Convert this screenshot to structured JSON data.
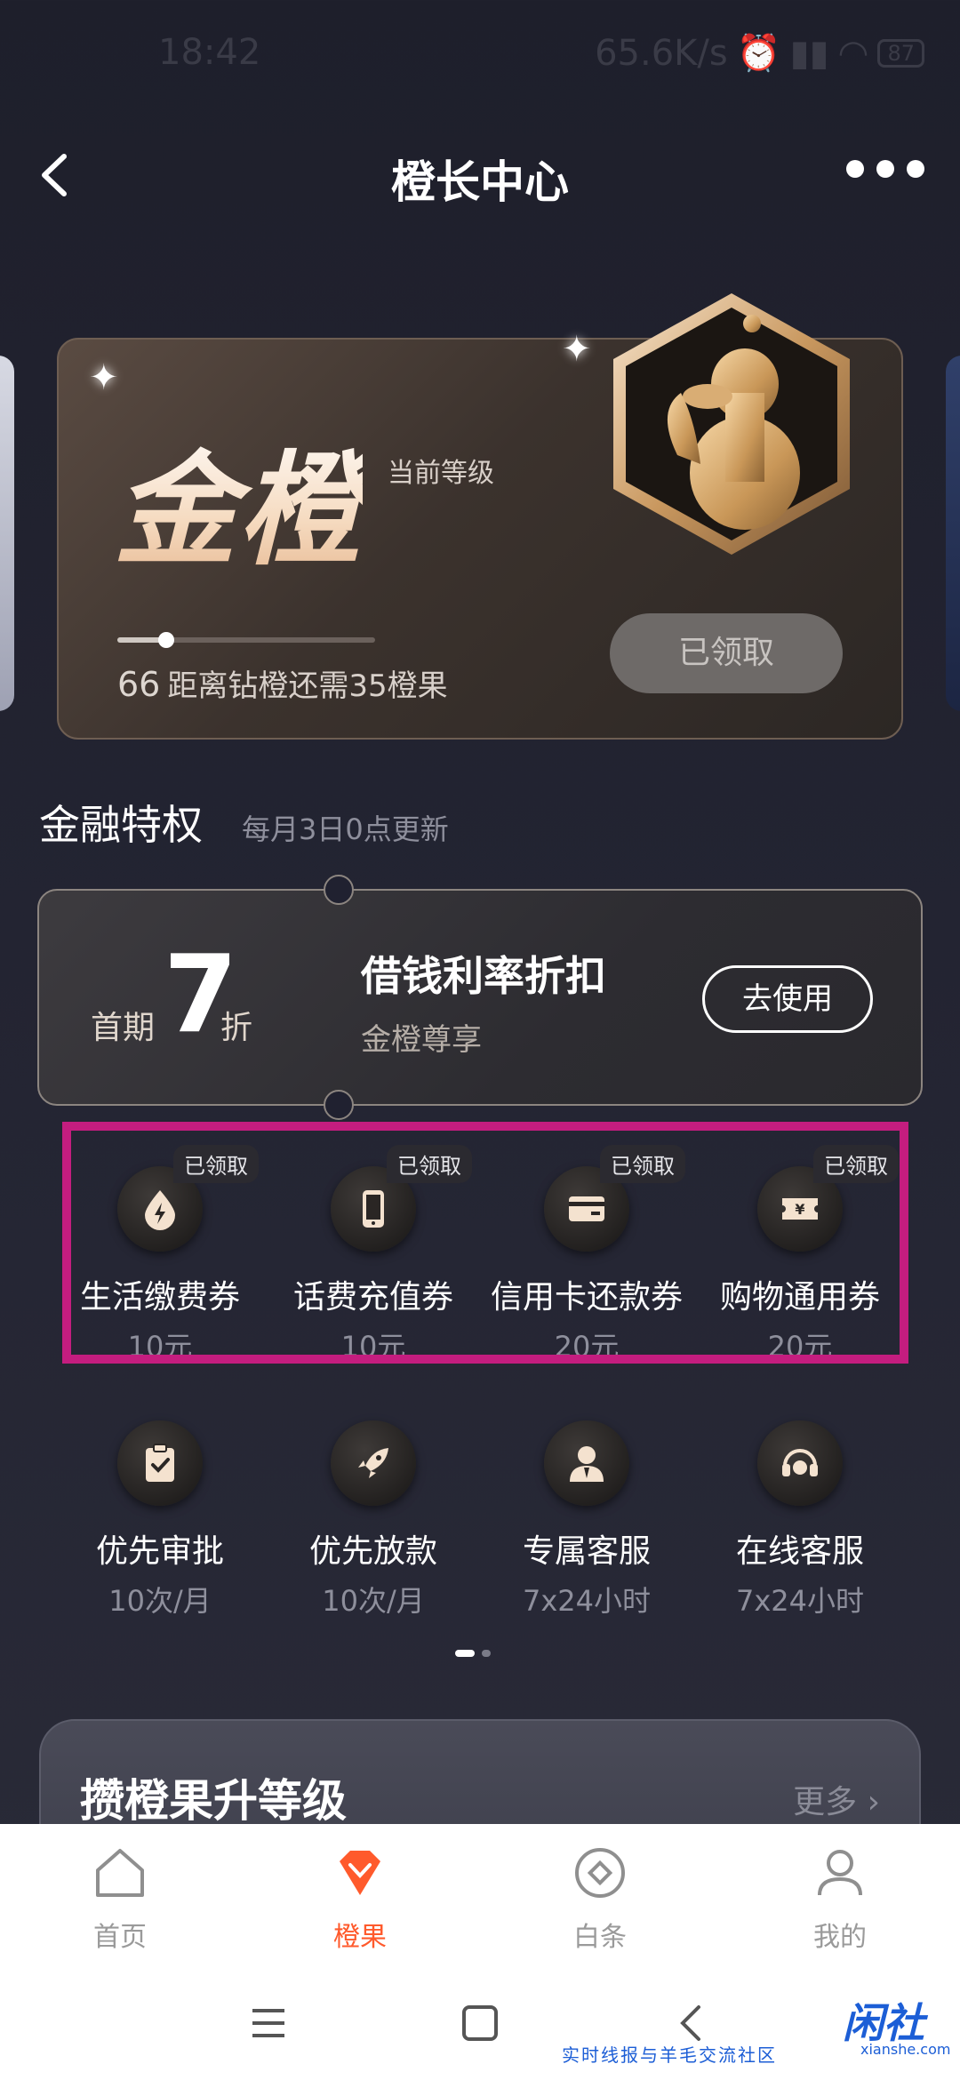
{
  "status_bar": {
    "time": "18:42",
    "net_speed": "65.6K/s",
    "battery": "87"
  },
  "header": {
    "title": "橙长中心"
  },
  "level_card": {
    "level_name": "金橙",
    "level_caption": "当前等级",
    "points": "66",
    "progress_text": "距离钻橙还需35橙果",
    "progress_fraction": 0.19,
    "claim_label": "已领取"
  },
  "finance": {
    "title": "金融特权",
    "subtitle": "每月3日0点更新",
    "ticket": {
      "prefix": "首期",
      "number": "7",
      "suffix": "折",
      "title": "借钱利率折扣",
      "desc": "金橙尊享",
      "button": "去使用"
    },
    "coupons": [
      {
        "label": "生活缴费券",
        "value": "10元",
        "tag": "已领取",
        "icon": "lightning-drop-icon"
      },
      {
        "label": "话费充值券",
        "value": "10元",
        "tag": "已领取",
        "icon": "phone-icon"
      },
      {
        "label": "信用卡还款券",
        "value": "20元",
        "tag": "已领取",
        "icon": "credit-card-icon"
      },
      {
        "label": "购物通用券",
        "value": "20元",
        "tag": "已领取",
        "icon": "yen-ticket-icon"
      }
    ],
    "services": [
      {
        "label": "优先审批",
        "value": "10次/月",
        "icon": "clipboard-check-icon"
      },
      {
        "label": "优先放款",
        "value": "10次/月",
        "icon": "rocket-icon"
      },
      {
        "label": "专属客服",
        "value": "7x24小时",
        "icon": "person-icon"
      },
      {
        "label": "在线客服",
        "value": "7x24小时",
        "icon": "headset-icon"
      }
    ]
  },
  "upgrade": {
    "title": "攒橙果升等级",
    "more": "更多"
  },
  "bottom_nav": [
    {
      "label": "首页",
      "icon": "home-icon"
    },
    {
      "label": "橙果",
      "icon": "orange-gem-icon",
      "active": true
    },
    {
      "label": "白条",
      "icon": "diamond-circle-icon"
    },
    {
      "label": "我的",
      "icon": "user-icon"
    }
  ],
  "watermark": {
    "logo": "闲社",
    "slogan": "实时线报与羊毛交流社区",
    "url": "xianshe.com"
  },
  "colors": {
    "accent": "#ff5a2c",
    "highlight_box": "#c41d7f"
  }
}
